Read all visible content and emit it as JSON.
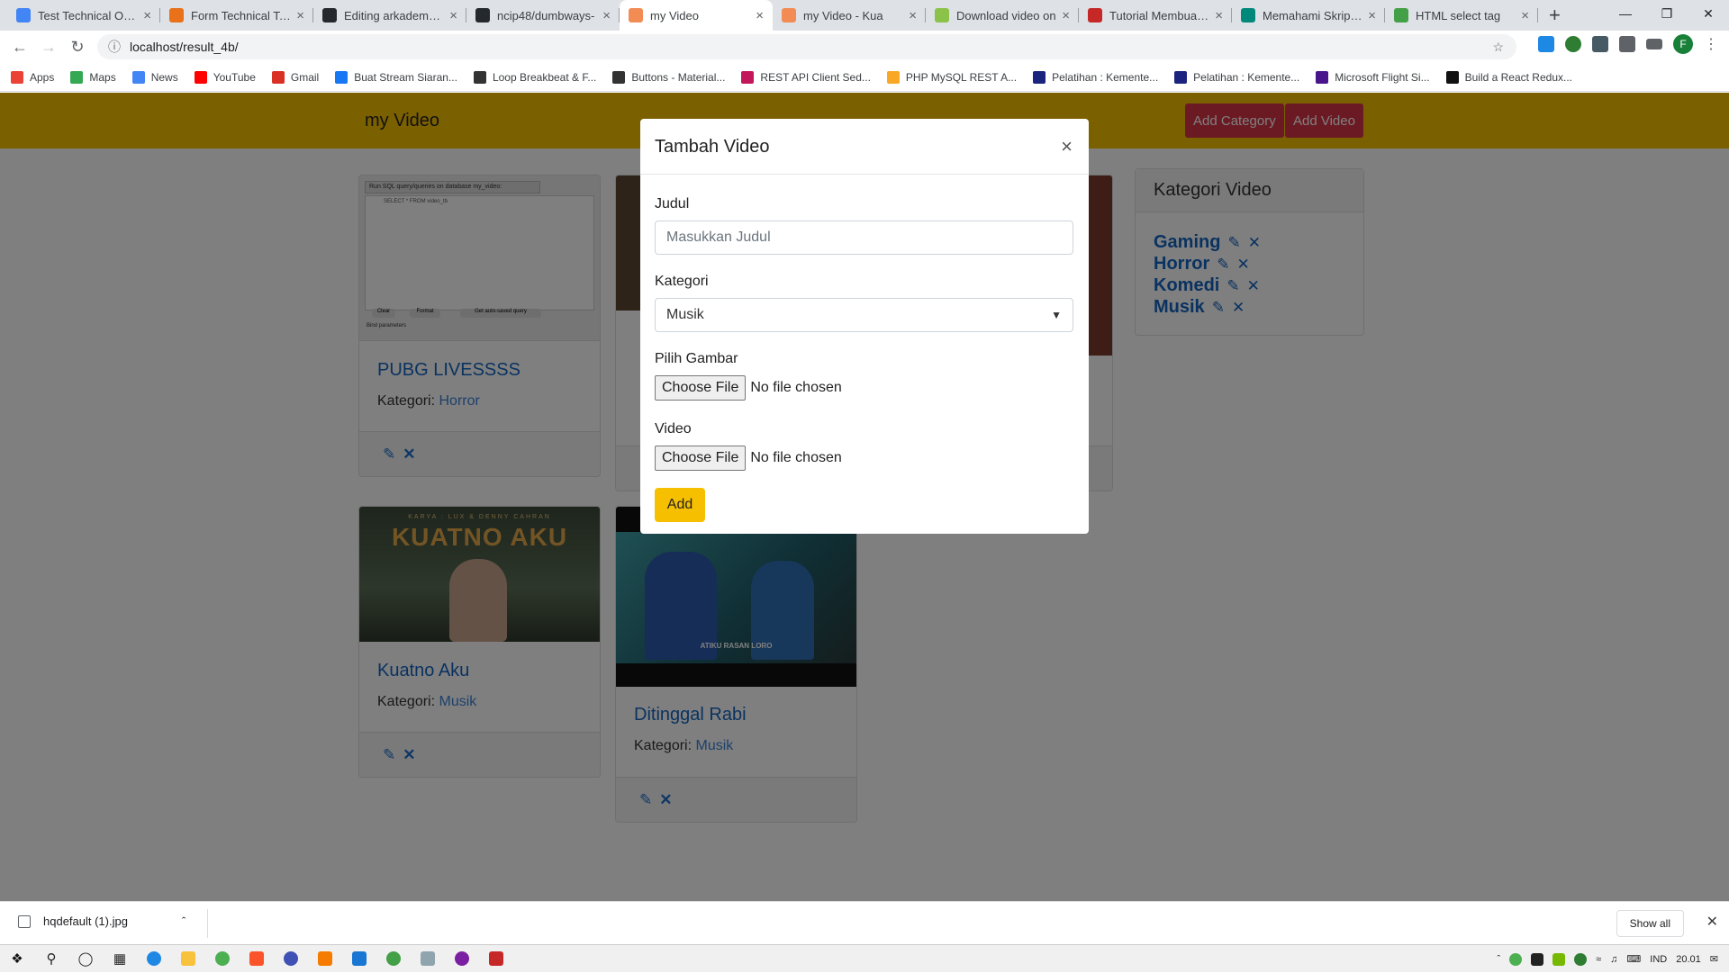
{
  "browser": {
    "tabs": [
      {
        "title": "Test Technical Onlin",
        "color": "#4285f4",
        "active": false
      },
      {
        "title": "Form Technical Test",
        "color": "#e8711a",
        "active": false
      },
      {
        "title": "Editing arkademy/R",
        "color": "#24292e",
        "active": false
      },
      {
        "title": "ncip48/dumbways-",
        "color": "#24292e",
        "active": false
      },
      {
        "title": "my Video",
        "color": "#f28b54",
        "active": true
      },
      {
        "title": "my Video - Kua",
        "color": "#f28b54",
        "active": false
      },
      {
        "title": "Download video on",
        "color": "#8bc34a",
        "active": false
      },
      {
        "title": "Tutorial Membuat C",
        "color": "#c62828",
        "active": false
      },
      {
        "title": "Memahami Skrip PH",
        "color": "#00897b",
        "active": false
      },
      {
        "title": "HTML select tag",
        "color": "#43a047",
        "active": false
      }
    ],
    "url": "localhost/result_4b/",
    "bookmarks": [
      {
        "label": "Apps",
        "color": "#ea4335"
      },
      {
        "label": "Maps",
        "color": "#34a853"
      },
      {
        "label": "News",
        "color": "#4285f4"
      },
      {
        "label": "YouTube",
        "color": "#ff0000"
      },
      {
        "label": "Gmail",
        "color": "#d93025"
      },
      {
        "label": "Buat Stream Siaran...",
        "color": "#1877f2"
      },
      {
        "label": "Loop Breakbeat & F...",
        "color": "#333333"
      },
      {
        "label": "Buttons - Material...",
        "color": "#333333"
      },
      {
        "label": "REST API Client Sed...",
        "color": "#c2185b"
      },
      {
        "label": "PHP MySQL REST A...",
        "color": "#f9a825"
      },
      {
        "label": "Pelatihan : Kemente...",
        "color": "#1a237e"
      },
      {
        "label": "Pelatihan : Kemente...",
        "color": "#1a237e"
      },
      {
        "label": "Microsoft Flight Si...",
        "color": "#4a148c"
      },
      {
        "label": "Build a React Redux...",
        "color": "#111111"
      }
    ]
  },
  "app": {
    "brand": "my Video",
    "add_category": "Add Category",
    "add_video": "Add Video",
    "cards": [
      {
        "title": "PUBG LIVESSSS",
        "category_label": "Kategori:",
        "category": "Horror",
        "thumb_color": "#e9e9e9"
      },
      {
        "title": "Kuatno Aku",
        "category_label": "Kategori:",
        "category": "Musik",
        "thumb_color": "#4a5a4c"
      },
      {
        "title": "Ditinggal Rabi",
        "category_label": "Kategori:",
        "category": "Musik",
        "thumb_color": "#2f6f7a"
      }
    ],
    "kategori_title": "Kategori Video",
    "kategori": [
      "Gaming",
      "Horror",
      "Komedi",
      "Musik"
    ],
    "thumb_texts": {
      "sql_title": "Run SQL query/queries on database my_video:",
      "sql_query": "SELECT * FROM video_tb",
      "sql_clear": "Clear",
      "sql_format": "Format",
      "sql_saved": "Get auto-saved query",
      "sql_bind": "Bind parameters",
      "kuatno_small": "KARYA : LUX & DENNY CAHRAN",
      "kuatno_big": "KUATNO AKU",
      "rabi_caption": "ATIKU RASAN LORO"
    }
  },
  "modal": {
    "title": "Tambah Video",
    "judul_label": "Judul",
    "judul_placeholder": "Masukkan Judul",
    "kategori_label": "Kategori",
    "kategori_value": "Musik",
    "gambar_label": "Pilih Gambar",
    "video_label": "Video",
    "choose_file": "Choose File",
    "no_file": "No file chosen",
    "add": "Add"
  },
  "downloads": {
    "file": "hqdefault (1).jpg",
    "show_all": "Show all"
  },
  "taskbar": {
    "lang": "IND",
    "time": "20.01"
  }
}
